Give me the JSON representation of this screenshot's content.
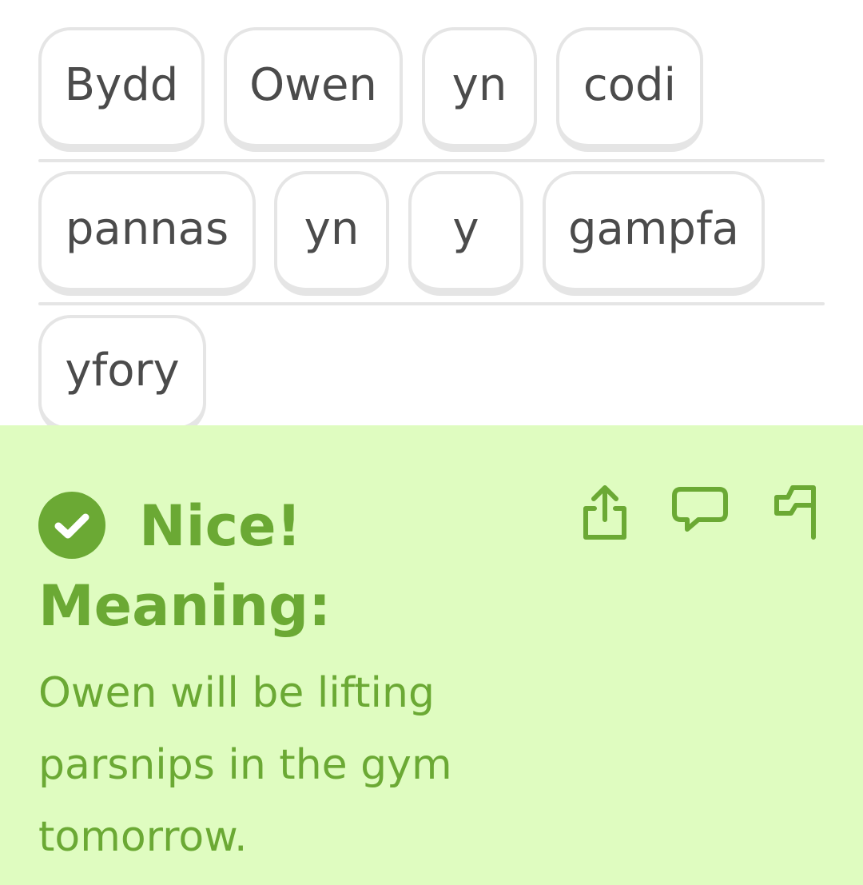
{
  "word_bank": {
    "row1": [
      "Bydd",
      "Owen",
      "yn",
      "codi"
    ],
    "row2": [
      "pannas",
      "yn",
      "y",
      "gampfa"
    ],
    "row3": [
      "yfory"
    ]
  },
  "feedback": {
    "status_icon": "check-circle-icon",
    "title": "Nice!",
    "meaning_label": "Meaning:",
    "meaning_text": "Owen will be lifting parsnips in the gym tomorrow.",
    "actions": [
      "share-icon",
      "comment-icon",
      "report-flag-icon"
    ],
    "colors": {
      "background": "#dffcc0",
      "accent": "#6ba934"
    }
  }
}
